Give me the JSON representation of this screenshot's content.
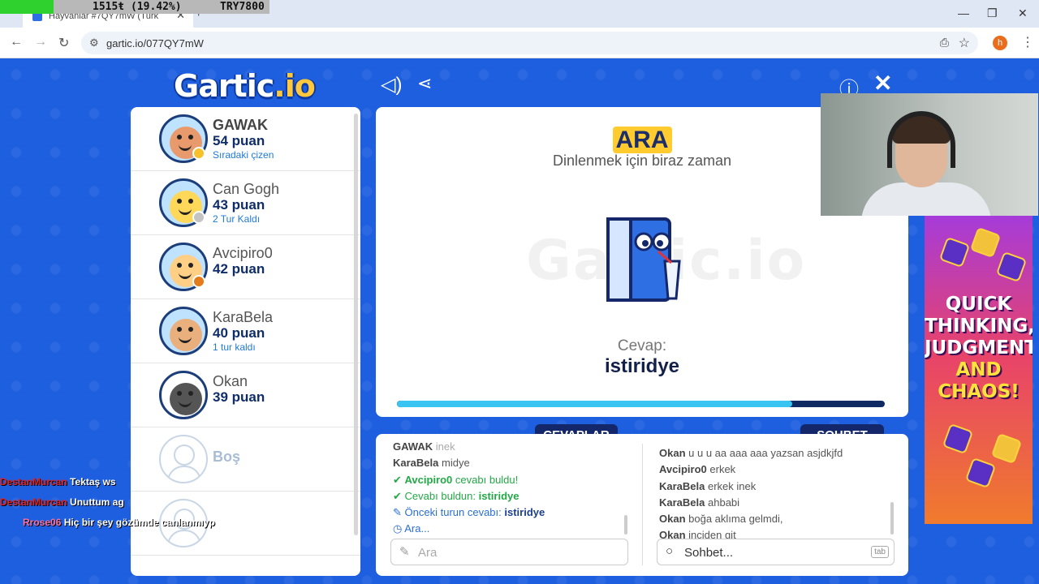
{
  "browser": {
    "tab_title": "Hayvanlar #7QY7mW (Türk",
    "url": "gartic.io/077QY7mW",
    "overlay_stat": "1515ŧ (19.42%)",
    "overlay_currency": "TRY7800",
    "profile_letter": "h"
  },
  "game": {
    "logo_main": "Gartic",
    "logo_suffix": ".io",
    "status_word": "ARA",
    "status_text": "Dinlenmek için biraz zaman",
    "watermark": "Gartic.io",
    "answer_label": "Cevap:",
    "answer_word": "istiridye",
    "progress": 0.81
  },
  "players": [
    {
      "name": "GAWAK",
      "score": "54 puan",
      "note": "Sıradaki çizen",
      "face": "#e89a6c",
      "dot": "#f6c12a",
      "bold": true
    },
    {
      "name": "Can Gogh",
      "score": "43 puan",
      "note": "2 Tur Kaldı",
      "face": "#ffd85a",
      "dot": "#c4c4c4",
      "bold": false
    },
    {
      "name": "Avcipiro0",
      "score": "42 puan",
      "note": "",
      "face": "#ffcf86",
      "dot": "#e57a1a",
      "bold": false
    },
    {
      "name": "KaraBela",
      "score": "40 puan",
      "note": "1 tur kaldı",
      "face": "#e9b07d",
      "dot": "",
      "bold": false
    },
    {
      "name": "Okan",
      "score": "39 puan",
      "note": "",
      "face": "#555555",
      "dot": "",
      "bold": false
    }
  ],
  "empty_slot": "Boş",
  "tabs": {
    "answers": "CEVAPLAR",
    "chat": "SOHBET"
  },
  "answers_log": [
    {
      "user": "GAWAK",
      "text": "inek",
      "kind": "faded"
    },
    {
      "user": "KaraBela",
      "text": "midye",
      "kind": "plain"
    },
    {
      "user": "Avcipiro0",
      "text": "cevabı buldu!",
      "kind": "ok"
    },
    {
      "user": "",
      "text": "Cevabı buldun:",
      "word": "istiridye",
      "kind": "ok2"
    },
    {
      "user": "",
      "text": "Önceki turun cevabı:",
      "word": "istiridye",
      "kind": "prev"
    },
    {
      "user": "",
      "text": "Ara...",
      "kind": "pend"
    }
  ],
  "chat_log": [
    {
      "user": "Okan",
      "text": "u u u aa aaa aaa yazsan asjdkjfd"
    },
    {
      "user": "Avcipiro0",
      "text": "erkek"
    },
    {
      "user": "KaraBela",
      "text": "erkek inek"
    },
    {
      "user": "KaraBela",
      "text": "ahbabi"
    },
    {
      "user": "Okan",
      "text": "boğa aklıma gelmdi,"
    },
    {
      "user": "Okan",
      "text": "inciden git"
    }
  ],
  "inputs": {
    "answer_placeholder": "Ara",
    "chat_placeholder": "Sohbet...",
    "tab_hint": "tab"
  },
  "ad": {
    "line1": "QUICK",
    "line2": "THINKING,",
    "line3": "JUDGMENT",
    "line4": "AND",
    "line5": "CHAOS!"
  },
  "stream_chat": [
    {
      "user": "DestanMurcan",
      "msg": "Tektaş ws"
    },
    {
      "user": "DestanMurcan",
      "msg": "Unuttum ag"
    },
    {
      "user": "Rrose06",
      "msg": "Hiç bir şey gözümde canlanmıyp"
    }
  ]
}
